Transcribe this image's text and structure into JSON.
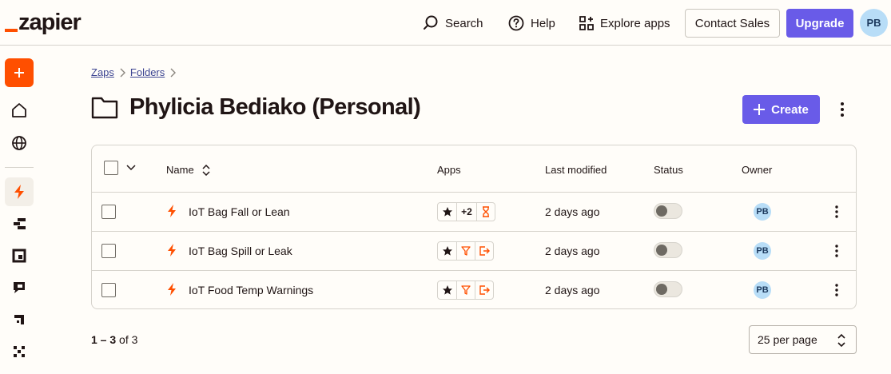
{
  "app": {
    "logo_text": "zapier",
    "brand_color": "#ff4f00",
    "accent_color": "#695be8"
  },
  "topbar": {
    "search_label": "Search",
    "help_label": "Help",
    "explore_label": "Explore apps",
    "contact_sales_label": "Contact Sales",
    "upgrade_label": "Upgrade",
    "avatar_initials": "PB"
  },
  "sidebar": {
    "items": [
      {
        "icon": "plus-icon"
      },
      {
        "icon": "home-icon"
      },
      {
        "icon": "globe-icon"
      },
      {
        "icon": "zap-icon",
        "active": true
      },
      {
        "icon": "tables-icon"
      },
      {
        "icon": "interfaces-icon"
      },
      {
        "icon": "chatbots-icon"
      },
      {
        "icon": "canvas-icon"
      },
      {
        "icon": "agents-icon"
      }
    ]
  },
  "breadcrumb": {
    "items": [
      "Zaps",
      "Folders"
    ]
  },
  "page": {
    "title": "Phylicia Bediako (Personal)",
    "create_label": "Create"
  },
  "table": {
    "columns": {
      "name": "Name",
      "apps": "Apps",
      "last_modified": "Last modified",
      "status": "Status",
      "owner": "Owner"
    },
    "rows": [
      {
        "name": "IoT Bag Fall or Lean",
        "apps": [
          "star-app-icon",
          "+2",
          "delay-icon"
        ],
        "last_modified": "2 days ago",
        "status_on": false,
        "owner": "PB"
      },
      {
        "name": "IoT Bag Spill or Leak",
        "apps": [
          "star-app-icon",
          "filter-icon",
          "exit-icon"
        ],
        "last_modified": "2 days ago",
        "status_on": false,
        "owner": "PB"
      },
      {
        "name": "IoT Food Temp Warnings",
        "apps": [
          "star-app-icon",
          "filter-icon",
          "exit-icon"
        ],
        "last_modified": "2 days ago",
        "status_on": false,
        "owner": "PB"
      }
    ]
  },
  "footer": {
    "range": "1 – 3",
    "of_label": "of 3",
    "per_page_label": "25 per page"
  }
}
